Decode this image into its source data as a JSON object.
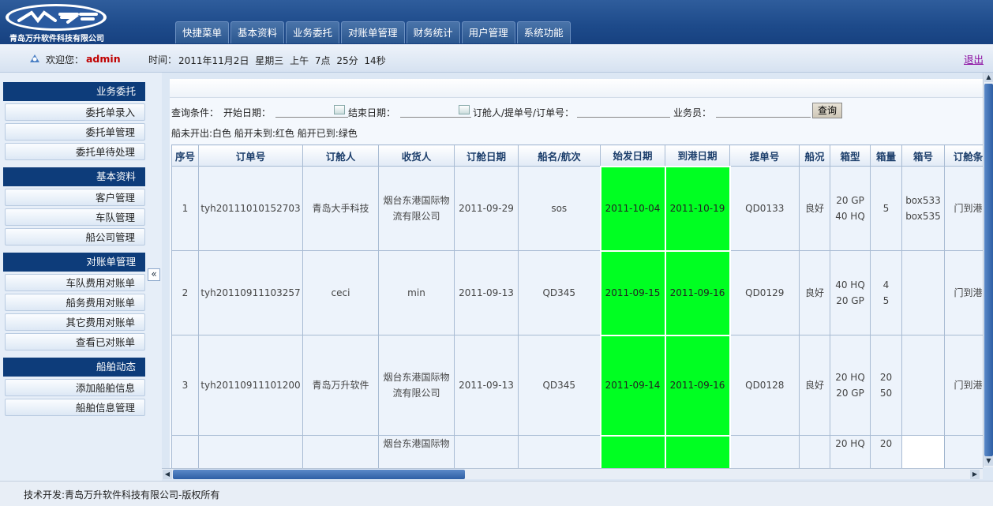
{
  "header": {
    "company": "青岛万升软件科技有限公司",
    "nav": [
      "快捷菜单",
      "基本资料",
      "业务委托",
      "对账单管理",
      "财务统计",
      "用户管理",
      "系统功能"
    ]
  },
  "welcome": {
    "label": "欢迎您：",
    "user": "admin",
    "time_label": "时间：",
    "time_value": "2011年11月2日 星期三 上午 7点 25分 14秒",
    "logout": "退出"
  },
  "sidebar": {
    "groups": [
      {
        "title": "业务委托",
        "items": [
          "委托单录入",
          "委托单管理",
          "委托单待处理"
        ]
      },
      {
        "title": "基本资料",
        "items": [
          "客户管理",
          "车队管理",
          "船公司管理"
        ]
      },
      {
        "title": "对账单管理",
        "items": [
          "车队费用对账单",
          "船务费用对账单",
          "其它费用对账单",
          "查看已对账单"
        ]
      },
      {
        "title": "船舶动态",
        "items": [
          "添加船舶信息",
          "船舶信息管理"
        ]
      }
    ],
    "collapse": "«"
  },
  "query": {
    "condition_label": "查询条件：",
    "start_label": "开始日期：",
    "end_label": "结束日期：",
    "order_label": "订舱人/提单号/订单号：",
    "salesman_label": "业务员：",
    "button": "查询",
    "legend": "船未开出:白色   船开未到:红色   船开已到:绿色"
  },
  "table": {
    "columns": [
      "序号",
      "订单号",
      "订舱人",
      "收货人",
      "订舱日期",
      "船名/航次",
      "始发日期",
      "到港日期",
      "提单号",
      "船况",
      "箱型",
      "箱量",
      "箱号",
      "订舱条"
    ],
    "rows": [
      {
        "no": "1",
        "order": "tyh20111010152703",
        "booker": "青岛大手科技",
        "consignee": "烟台东港国际物流有限公司",
        "date": "2011-09-29",
        "vessel": "sos",
        "depart": "2011-10-04",
        "arrive": "2011-10-19",
        "bl": "QD0133",
        "status": "良好",
        "type": "20 GP\n40 HQ",
        "qty": "5",
        "box": "box533\nbox535",
        "term": "门到港"
      },
      {
        "no": "2",
        "order": "tyh20110911103257",
        "booker": "ceci",
        "consignee": "min",
        "date": "2011-09-13",
        "vessel": "QD345",
        "depart": "2011-09-15",
        "arrive": "2011-09-16",
        "bl": "QD0129",
        "status": "良好",
        "type": "40 HQ\n20 GP",
        "qty": "4\n5",
        "box": "",
        "term": "门到港"
      },
      {
        "no": "3",
        "order": "tyh20110911101200",
        "booker": "青岛万升软件",
        "consignee": "烟台东港国际物流有限公司",
        "date": "2011-09-13",
        "vessel": "QD345",
        "depart": "2011-09-14",
        "arrive": "2011-09-16",
        "bl": "QD0128",
        "status": "良好",
        "type": "20 HQ\n20 GP",
        "qty": "20\n50",
        "box": "",
        "term": "门到港"
      },
      {
        "no": "",
        "order": "",
        "booker": "",
        "consignee": "烟台东港国际物",
        "date": "",
        "vessel": "",
        "depart": "",
        "arrive": "",
        "bl": "",
        "status": "",
        "type": "20 HQ",
        "qty": "20",
        "box": "",
        "term": ""
      }
    ]
  },
  "footer": {
    "text": "技术开发:青岛万升软件科技有限公司-版权所有"
  }
}
